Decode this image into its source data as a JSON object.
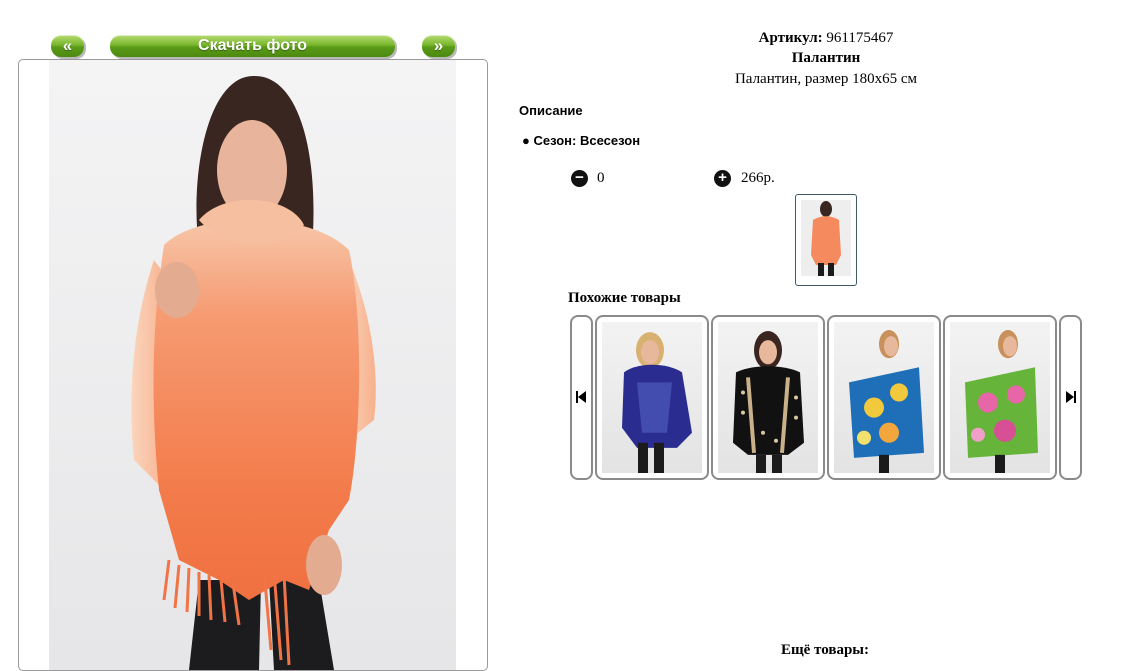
{
  "nav": {
    "prev_label": "«",
    "download_label": "Скачать фото",
    "next_label": "»"
  },
  "product": {
    "article_label": "Артикул:",
    "article_value": "961175467",
    "name": "Палантин",
    "subtitle": "Палантин, размер 180х65 см",
    "description_heading": "Описание",
    "season": "Сезон: Всесезон",
    "quantity": "0",
    "price": "266р."
  },
  "similar": {
    "title": "Похожие товары",
    "items": [
      {
        "desc": "woman in navy paisley scarf"
      },
      {
        "desc": "woman in black polka-dot scarf with beige trim"
      },
      {
        "desc": "woman holding blue floral scarf"
      },
      {
        "desc": "woman holding green scarf with pink roses"
      }
    ]
  },
  "more": {
    "title": "Ещё товары:"
  },
  "icons": {
    "minus": "minus-circle-icon",
    "plus": "plus-circle-icon",
    "first": "skip-first-icon",
    "last": "skip-last-icon"
  },
  "colors": {
    "button_green": "#79b72c",
    "scarf_coral": "#f37f52",
    "frame_border": "#9a9a9a"
  }
}
